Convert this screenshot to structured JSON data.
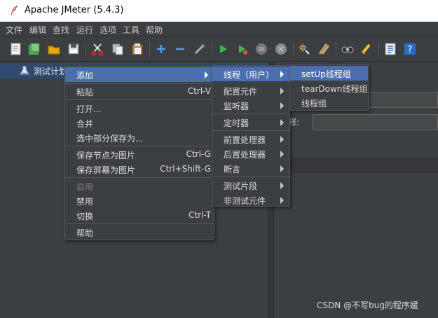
{
  "window": {
    "title": "Apache JMeter (5.4.3)"
  },
  "menubar": [
    "文件",
    "编辑",
    "查找",
    "运行",
    "选项",
    "工具",
    "帮助"
  ],
  "toolbar_icons": [
    "new-icon",
    "templates-icon",
    "open-icon",
    "save-icon",
    "cut-icon",
    "copy-icon",
    "paste-icon",
    "expand-icon",
    "collapse-icon",
    "toggle-icon",
    "start-icon",
    "start-no-pause-icon",
    "stop-icon",
    "shutdown-icon",
    "clear-icon",
    "clear-all-icon",
    "search-icon",
    "reset-search-icon",
    "function-helper-icon",
    "help-icon"
  ],
  "tree": {
    "node_label": "测试计划"
  },
  "context_menu": {
    "add": "添加",
    "paste": "粘贴",
    "paste_shortcut": "Ctrl-V",
    "open": "打开...",
    "merge": "合并",
    "save_selection_as": "选中部分保存为...",
    "save_node_as_image": "保存节点为图片",
    "save_node_as_image_shortcut": "Ctrl-G",
    "save_screen_as_image": "保存屏幕为图片",
    "save_screen_as_image_shortcut": "Ctrl+Shift-G",
    "enable": "启用",
    "disable": "禁用",
    "toggle": "切换",
    "toggle_shortcut": "Ctrl-T",
    "help": "帮助"
  },
  "add_submenu": {
    "threads": "线程（用户）",
    "config_element": "配置元件",
    "listener": "监听器",
    "timer": "定时器",
    "pre_processor": "前置处理器",
    "post_processor": "后置处理器",
    "assertion": "断言",
    "test_fragment": "测试片段",
    "non_test_element": "非测试元件"
  },
  "threads_submenu": {
    "setup_thread_group": "setUp线程组",
    "teardown_thread_group": "tearDown线程组",
    "thread_group": "线程组"
  },
  "right_panel": {
    "comment_label": "释:"
  },
  "watermark": "CSDN @不写bug的程序媛",
  "colors": {
    "background": "#3c3f41",
    "selection": "#4b6eaf",
    "menu_border": "#555757"
  }
}
